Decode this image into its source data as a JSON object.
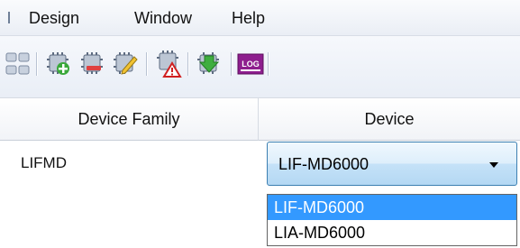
{
  "menu": {
    "items": [
      {
        "label": "Design"
      },
      {
        "label": "Window"
      },
      {
        "label": "Help"
      }
    ]
  },
  "toolbar": {
    "icons": [
      "device-grid-icon",
      "add-device-icon",
      "remove-device-icon",
      "edit-device-icon",
      "warning-device-icon",
      "download-device-icon",
      "log-icon"
    ],
    "log_text": "LOG"
  },
  "table": {
    "columns": [
      "Device Family",
      "Device"
    ],
    "row": {
      "family": "LIFMD",
      "device": "LIF-MD6000"
    }
  },
  "dropdown": {
    "options": [
      "LIF-MD6000",
      "LIA-MD6000"
    ],
    "selected_index": 0
  },
  "colors": {
    "selection": "#3399ff",
    "combo_border": "#3c7fb1",
    "log_icon": "#8e1e8e"
  }
}
